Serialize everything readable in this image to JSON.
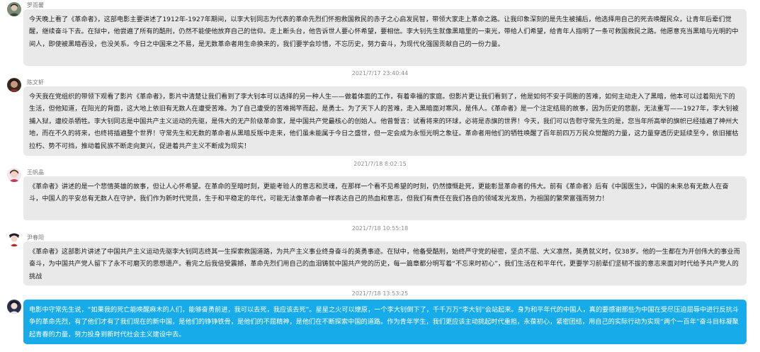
{
  "messages": [
    {
      "sender": "罗雨馨",
      "avatar": "avatar-photo-icon",
      "text": "今天晚上看了《革命者》，这部电影主要讲述了1912年-1927年期间，以李大钊同志为代表的革命先烈们怀抱救国救民的赤子之心启发民智，带领大家走上革命之路。让我印象深刻的是先生被捕后，他选择用自己的死去唤醒民众，让青年后辈们觉醒，继续奋斗下去。在狱中，他尝遍了所有的酷刑，仍然不能使他放弃自己的信仰。走上断头台，他告诉世人要心怀希望，要相信。李大钊先生就像黑暗里的一束光，带给人们希望，给青年人指明了一条可救国救民之路。他愿意充当黑暗与光明的中间人，即使被黑暗吞没，也没关系。今日之中国来之不易，是无数革命者用生命换来的，我们要学会珍惜，不忘历史，努力奋斗，为现代化强国贡献自己的一份力量。"
    },
    {
      "time": "2021/7/17 23:40:44",
      "sender": "陈文轩",
      "avatar": "avatar-photo-icon",
      "text": "今天我在党组织的带领下观看了影片《革命者》，影片中清楚让我们看到了李大钊本可以选择的另一种人生——做着体面的工作，有着幸福的家庭。但影片更让我们看到了，他是如何不安于同胞的苦难，如何主动走入了黑暗，他本可以过着阳光下的生活，但他知道，在阳光的背面，这大地上依旧有无数人在遭受苦难。为了自己遭受的苦难揭竿而起，是勇士。为了天下人的苦难，走入黑暗面对寒风，是伟人。《革命者》是一个注定结局的故事，因为历史的悲剧，无法重写——1927年，李大钊被捕入狱，遭绞杀牺牲。李大钊同志是中国共产主义运动的先驱，是伟大的无产阶级革命家，是中国共产党最核心的创始人。他曾誓言：试看将来的环球，必将是赤旗的世界！今天，我们可以告慰守常先生的是，您当年所高举的旗帜已经插遍了神州大地，而在不久的将来，也终将插遍整个世界！守常先生和无数的革命者从黑暗反叛中走来，他们虽未能属于今日之盛世，但一定会成为永恒光明之象征。革命者用他们的牺牲唤醒了百年前四万万民众觉醒的力量，这力量穿透历史延续至今，依旧摧枯拉朽、势不可挡，推动着民族不断走向复兴，促进着共产主义不断成为现实！"
    },
    {
      "time": "2021/7/18 8:02:15",
      "sender": "王帆晶",
      "avatar": "avatar-photo-icon",
      "text": "《革命者》讲述的是一个悲情英雄的故事，但让人心怀希望。在革命的至暗时刻，更能考验人的意志和灵魂，在那样一个看不见希望的时刻，仍然慷慨赴死，更能彰显革命者的伟大。前有《革命者》后有《中国医生》，中国的未来总有无数人在奋斗，中国人的平安总有无数人在守护，我们作为新时代党员，生于和平稳定的年代，可能无法像革命者一样表达自己的热血和意志，但我们有责任在我们各自的领域发光发热，为祖国的繁荣富强而努力！"
    },
    {
      "time": "2021/7/18 10:55:18",
      "sender": "尹春阳",
      "avatar": "avatar-photo-icon",
      "text": "《革命者》这部影片讲述了中国共产主义运动先驱李大钊同志终其一生探索救国道路，为共产主义事业终身奋斗的英勇事迹。在狱中，他备受酷刑，始终严守党的秘密，坚贞不屈、大义凛然，英勇就义时，仅38岁。他的一生都在为开创伟大的事业而奋斗，为中国共产党人留下了永不可磨灭的思想遗产。看完之后我倍受震撼，革命先烈们用自己的血泪铸就中国共产党的历史，每一篇章都分明写着“不忘来时初心”，我们生活在和平年代，更要学习前辈们坚韧不拔的意志来面对时代给予共产党人的挑战"
    },
    {
      "time": "2021/7/18 13:53:25",
      "sender": "",
      "avatar": "avatar-photo-icon",
      "self": true,
      "text": "电影中守常先生说，“如果我的死亡能唤醒麻木的人们，能够奋勇前进，我可以去死，我应该去死”。星星之火可以燎原，一个李大钊倒下了，千千万万“李大钊”会站起来。身为和平年代的中国人，真的要感谢那些为中国在受尽压迫屈辱中进行反抗斗争的革命先烈，有了他们才有了我们现在的新中国，是他们的铮铮铁骨，是他们的不屈精神，是他们在不断探索中国的道路。作为青年学生，我们更应该主动挑起时代重担，永葆初心，紧密团结，用自己的实际行动为实现“两个一百年”奋斗目标凝聚起青春的力量，努力投身到新时代社会主义建设中去。"
    }
  ]
}
